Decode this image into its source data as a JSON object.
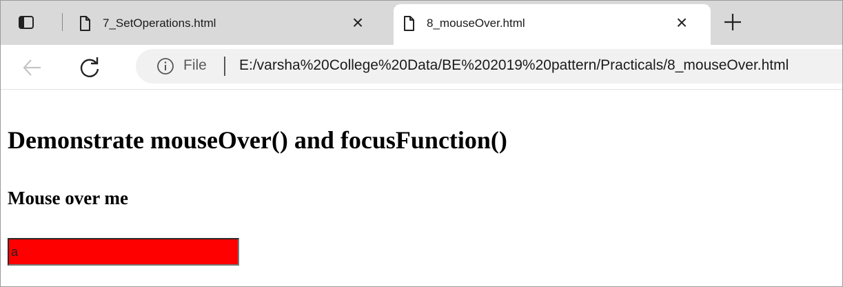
{
  "tabs": [
    {
      "title": "7_SetOperations.html",
      "active": false,
      "close_glyph": "×"
    },
    {
      "title": "8_mouseOver.html",
      "active": true,
      "close_glyph": "×"
    }
  ],
  "new_tab_icon": "plus-icon",
  "address_bar": {
    "info_icon": "info-icon",
    "scheme_label": "File",
    "url": "E:/varsha%20College%20Data/BE%202019%20pattern/Practicals/8_mouseOver.html"
  },
  "page": {
    "heading": "Demonstrate mouseOver() and focusFunction()",
    "subheading": "Mouse over me",
    "input_value": "a",
    "input_background": "#ff0000"
  },
  "colors": {
    "tabstrip_bg": "#d9d9d9",
    "active_tab_bg": "#ffffff",
    "address_bg": "#f1f1f1"
  }
}
